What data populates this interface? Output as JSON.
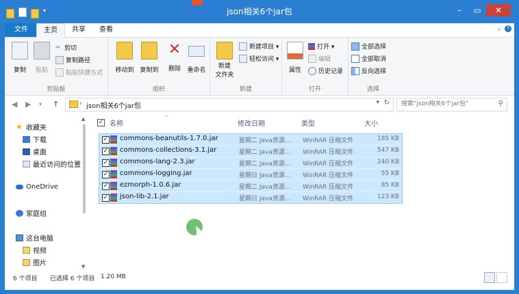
{
  "window": {
    "title": "json相关6个jar包"
  },
  "ribbon": {
    "tabs": [
      "文件",
      "主页",
      "共享",
      "查看"
    ],
    "groups": {
      "clipboard": {
        "label": "剪贴板",
        "copy": "复制",
        "paste": "粘贴",
        "cut": "剪切",
        "copy_path": "复制路径",
        "paste_shortcut": "粘贴快捷方式"
      },
      "organize": {
        "label": "组织",
        "move_to": "移动到",
        "copy_to": "复制到",
        "delete": "删除",
        "rename": "重命名"
      },
      "new": {
        "label": "新建",
        "new_folder_line1": "新建",
        "new_folder_line2": "文件夹",
        "new_item": "新建项目 ▾",
        "easy_access": "轻松访问 ▾"
      },
      "open": {
        "label": "打开",
        "properties": "属性",
        "open": "打开 ▾",
        "edit": "编辑",
        "history": "历史记录"
      },
      "select": {
        "label": "选择",
        "select_all": "全部选择",
        "select_none": "全部取消",
        "invert": "反向选择"
      }
    }
  },
  "address": {
    "crumb": "json相关6个jar包",
    "search_placeholder": "搜索\"json相关6个jar包\""
  },
  "nav": {
    "favorites": "收藏夹",
    "downloads": "下载",
    "desktop": "桌面",
    "recent": "最近访问的位置",
    "onedrive": "OneDrive",
    "homegroup": "家庭组",
    "thispc": "这台电脑",
    "videos": "视频",
    "pictures": "图片"
  },
  "columns": {
    "name": "名称",
    "date": "修改日期",
    "type": "类型",
    "size": "大小"
  },
  "files": [
    {
      "name": "commons-beanutils-1.7.0.jar",
      "date": "星期二 Java资源...",
      "type": "WinRAR 压缩文件",
      "size": "185 KB"
    },
    {
      "name": "commons-collections-3.1.jar",
      "date": "星期二 Java资源...",
      "type": "WinRAR 压缩文件",
      "size": "547 KB"
    },
    {
      "name": "commons-lang-2.3.jar",
      "date": "星期二 Java资源...",
      "type": "WinRAR 压缩文件",
      "size": "240 KB"
    },
    {
      "name": "commons-logging.jar",
      "date": "星期日 Java资源...",
      "type": "WinRAR 压缩文件",
      "size": "55 KB"
    },
    {
      "name": "ezmorph-1.0.6.jar",
      "date": "星期二 Java资源...",
      "type": "WinRAR 压缩文件",
      "size": "85 KB"
    },
    {
      "name": "json-lib-2.1.jar",
      "date": "星期日 Java资源...",
      "type": "WinRAR 压缩文件",
      "size": "123 KB"
    }
  ],
  "status": {
    "count": "6 个项目",
    "selected": "已选择 6 个项目",
    "size": "1.20 MB"
  },
  "colors": {
    "titlebar": "#2a7fd3",
    "selection": "#cce8ff",
    "selection_border": "#99c9ef"
  }
}
